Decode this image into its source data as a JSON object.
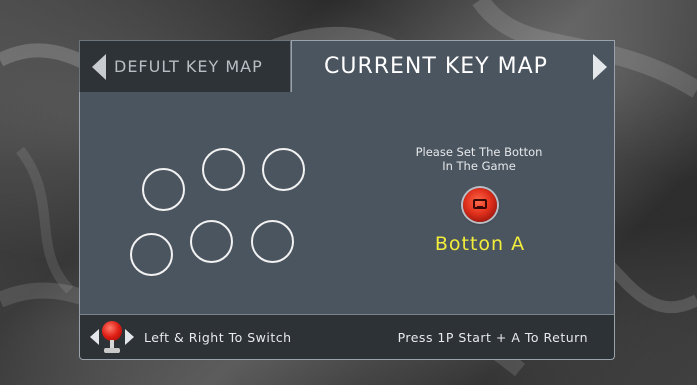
{
  "tabs": {
    "inactive_label": "DEFULT KEY MAP",
    "active_label": "CURRENT KEY MAP"
  },
  "prompt": {
    "line1": "Please Set The Botton",
    "line2": "In The Game"
  },
  "selected_key": "Botton A",
  "footer": {
    "left_hint": "Left & Right To Switch",
    "right_hint": "Press 1P Start + A To Return"
  },
  "icons": {
    "tab_prev": "arrow-left-icon",
    "tab_next": "arrow-right-icon",
    "joystick": "joystick-icon",
    "red_button": "arcade-button-icon"
  },
  "colors": {
    "panel": "#4b5560",
    "footer": "#2d3237",
    "highlight_text": "#f2ec3a",
    "button_red": "#e0301c"
  }
}
